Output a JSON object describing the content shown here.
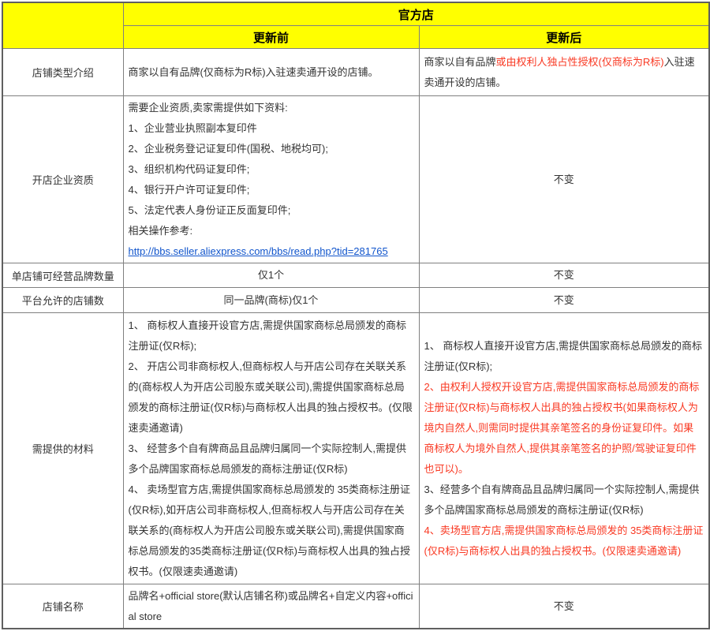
{
  "title": "官方店",
  "columns": {
    "before": "更新前",
    "after": "更新后"
  },
  "colors": {
    "header_bg": "#ffff00",
    "red": "#f93822",
    "link": "#1155cc",
    "border": "#808080"
  },
  "rows": [
    {
      "label": "店铺类型介绍",
      "before": {
        "align": "left",
        "paragraphs": [
          [
            {
              "t": "商家以自有品牌(仅商标为R标)入驻速卖通开设的店铺。"
            }
          ]
        ]
      },
      "after": {
        "align": "left",
        "paragraphs": [
          [
            {
              "t": "商家以自有品牌"
            },
            {
              "t": "或由权利人独占性授权(仅商标为R标)",
              "style": "red"
            },
            {
              "t": "入驻速卖通开设的店铺。"
            }
          ]
        ]
      }
    },
    {
      "label": "开店企业资质",
      "before": {
        "align": "left",
        "paragraphs": [
          [
            {
              "t": "需要企业资质,卖家需提供如下资料:"
            }
          ],
          [
            {
              "t": "1、企业营业执照副本复印件"
            }
          ],
          [
            {
              "t": "2、企业税务登记证复印件(国税、地税均可);"
            }
          ],
          [
            {
              "t": "3、组织机构代码证复印件;"
            }
          ],
          [
            {
              "t": "4、银行开户许可证复印件;"
            }
          ],
          [
            {
              "t": "5、法定代表人身份证正反面复印件;"
            }
          ],
          [
            {
              "t": "相关操作参考:"
            }
          ],
          [
            {
              "t": "http://bbs.seller.aliexpress.com/bbs/read.php?tid=281765",
              "style": "link"
            }
          ]
        ]
      },
      "after": {
        "align": "center",
        "paragraphs": [
          [
            {
              "t": "不变"
            }
          ]
        ]
      }
    },
    {
      "label": "单店铺可经营品牌数量",
      "before": {
        "align": "center",
        "paragraphs": [
          [
            {
              "t": "仅1个"
            }
          ]
        ]
      },
      "after": {
        "align": "center",
        "paragraphs": [
          [
            {
              "t": "不变"
            }
          ]
        ]
      }
    },
    {
      "label": "平台允许的店铺数",
      "before": {
        "align": "center",
        "paragraphs": [
          [
            {
              "t": "同一品牌(商标)仅1个"
            }
          ]
        ]
      },
      "after": {
        "align": "center",
        "paragraphs": [
          [
            {
              "t": "不变"
            }
          ]
        ]
      }
    },
    {
      "label": "需提供的材料",
      "before": {
        "align": "left",
        "paragraphs": [
          [
            {
              "t": "1、 商标权人直接开设官方店,需提供国家商标总局颁发的商标注册证(仅R标);"
            }
          ],
          [
            {
              "t": "2、 开店公司非商标权人,但商标权人与开店公司存在关联关系的(商标权人为开店公司股东或关联公司),需提供国家商标总局颁发的商标注册证(仅R标)与商标权人出具的独占授权书。(仅限速卖通邀请)"
            }
          ],
          [
            {
              "t": "3、 经营多个自有牌商品且品牌归属同一个实际控制人,需提供多个品牌国家商标总局颁发的商标注册证(仅R标)"
            }
          ],
          [
            {
              "t": "4、 卖场型官方店,需提供国家商标总局颁发的 35类商标注册证(仅R标),如开店公司非商标权人,但商标权人与开店公司存在关联关系的(商标权人为开店公司股东或关联公司),需提供国家商标总局颁发的35类商标注册证(仅R标)与商标权人出具的独占授权书。(仅限速卖通邀请)"
            }
          ]
        ]
      },
      "after": {
        "align": "left",
        "paragraphs": [
          [
            {
              "t": "1、 商标权人直接开设官方店,需提供国家商标总局颁发的商标注册证(仅R标);"
            }
          ],
          [
            {
              "t": "2、由权利人授权开设官方店,需提供国家商标总局颁发的商标注册证(仅R标)与商标权人出具的独占授权书(如果商标权人为境内自然人,则需同时提供其亲笔签名的身份证复印件。如果商标权人为境外自然人,提供其亲笔签名的护照/驾驶证复印件也可以)。",
              "style": "red"
            }
          ],
          [
            {
              "t": "3、经营多个自有牌商品且品牌归属同一个实际控制人,需提供多个品牌国家商标总局颁发的商标注册证(仅R标)"
            }
          ],
          [
            {
              "t": "4、卖场型官方店,需提供国家商标总局颁发的 35类商标注册证(仅R标)与商标权人出具的独占授权书。(仅限速卖通邀请)",
              "style": "red"
            }
          ]
        ]
      }
    },
    {
      "label": "店铺名称",
      "before": {
        "align": "left",
        "paragraphs": [
          [
            {
              "t": "品牌名+official store(默认店铺名称)或品牌名+自定义内容+official store"
            }
          ]
        ]
      },
      "after": {
        "align": "center",
        "paragraphs": [
          [
            {
              "t": "不变"
            }
          ]
        ]
      }
    }
  ]
}
